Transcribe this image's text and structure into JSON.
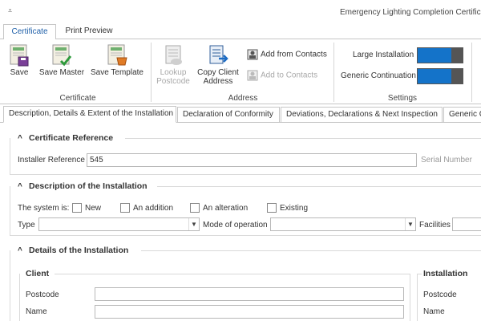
{
  "window": {
    "title": "Emergency Lighting Completion Certificat",
    "qa_icon": "⩡"
  },
  "ribbon_tabs": [
    {
      "label": "Certificate"
    },
    {
      "label": "Print Preview"
    }
  ],
  "ribbon": {
    "certificate_group": {
      "label": "Certificate",
      "save": "Save",
      "save_master": "Save Master",
      "save_template": "Save Template"
    },
    "address_group": {
      "label": "Address",
      "lookup_postcode_1": "Lookup",
      "lookup_postcode_2": "Postcode",
      "copy_client_1": "Copy Client",
      "copy_client_2": "Address",
      "add_from_contacts": "Add from Contacts",
      "add_to_contacts": "Add to Contacts"
    },
    "settings_group": {
      "label": "Settings",
      "large_installation": "Large Installation",
      "generic_continuation": "Generic Continuation"
    }
  },
  "doc_tabs": [
    {
      "label": "Description, Details & Extent of the Installation"
    },
    {
      "label": "Declaration of Conformity"
    },
    {
      "label": "Deviations, Declarations & Next Inspection"
    },
    {
      "label": "Generic C"
    }
  ],
  "cert_ref": {
    "title": "Certificate Reference",
    "installer_ref_label": "Installer Reference",
    "installer_ref_value": "545",
    "serial_label": "Serial Number"
  },
  "description": {
    "title": "Description of the Installation",
    "system_is": "The system is:",
    "new": "New",
    "addition": "An addition",
    "alteration": "An alteration",
    "existing": "Existing",
    "type_label": "Type",
    "mode_label": "Mode of operation",
    "facilities_label": "Facilities"
  },
  "details": {
    "title": "Details of the Installation",
    "client": "Client",
    "installation": "Installation",
    "postcode": "Postcode",
    "name": "Name",
    "postcode2": "Postcode",
    "name2": "Name"
  }
}
